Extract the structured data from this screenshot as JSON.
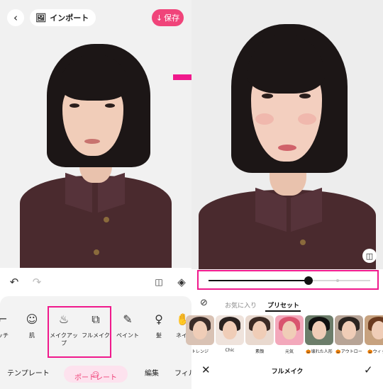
{
  "left": {
    "back_icon": "chevron-left-icon",
    "import_label": "インポート",
    "save_label": "保存",
    "features": [
      {
        "label": "ッチ",
        "icon": "brush-icon"
      },
      {
        "label": "肌",
        "icon": "face-icon"
      },
      {
        "label": "メイクアッ\nプ",
        "icon": "makeup-icon"
      },
      {
        "label": "フルメイク",
        "icon": "full-makeup-icon"
      },
      {
        "label": "ペイント",
        "icon": "paint-wand-icon"
      },
      {
        "label": "髪",
        "icon": "hair-icon"
      },
      {
        "label": "ネイル",
        "icon": "nail-icon"
      }
    ],
    "bottom_tabs": {
      "template": "テンプレート",
      "portrait": "ポートレート",
      "edit": "編集",
      "filter": "フィルタ"
    }
  },
  "right": {
    "slider": {
      "value": 0.62
    },
    "tabs": {
      "favorites": "お気に入り",
      "presets": "プリセット"
    },
    "presets": [
      {
        "label": "ナチュラル（トレンジ）",
        "display": "トレンジ",
        "hair": "#3a2c28",
        "bg": "#d9c2b4"
      },
      {
        "label": "Chic",
        "display": "Chic",
        "hair": "#2a2220",
        "bg": "#efe3dc"
      },
      {
        "label": "素顔",
        "display": "素顔",
        "hair": "#3b2a24",
        "bg": "#e9d9cf"
      },
      {
        "label": "元気",
        "display": "元気",
        "hair": "#d9556f",
        "bg": "#f3a8bb"
      },
      {
        "label": "壊れた人形",
        "display": "🎃壊れた人形",
        "hair": "#111111",
        "bg": "#6c7d6a"
      },
      {
        "label": "アウトロー",
        "display": "🎃アウトロー",
        "hair": "#2b2420",
        "bg": "#b7a496"
      },
      {
        "label": "ウィッチ",
        "display": "🎃ウィッチ",
        "hair": "#6b3a1f",
        "bg": "#c7a27f"
      }
    ],
    "footer_title": "フルメイク"
  }
}
